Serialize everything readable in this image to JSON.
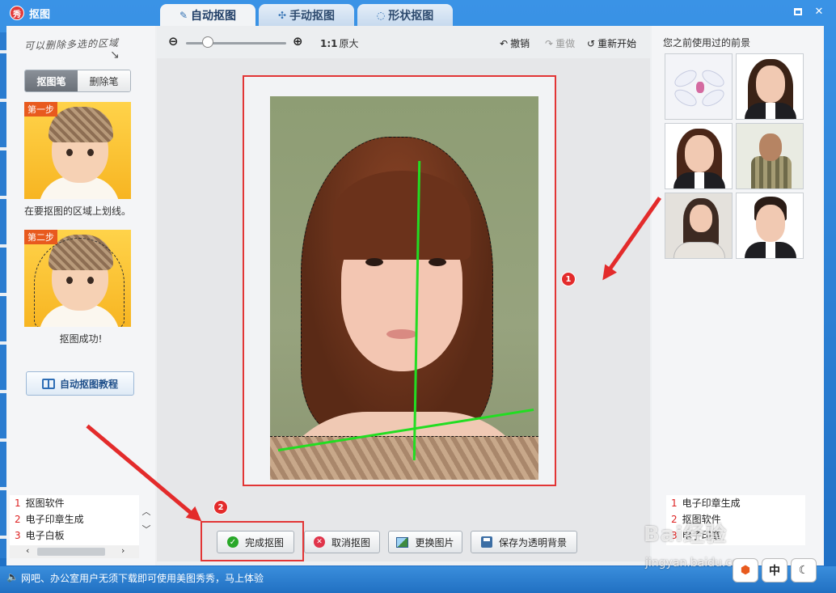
{
  "app": {
    "title": "抠图",
    "logo_char": "秀"
  },
  "tabs": [
    {
      "label": "自动抠图",
      "active": true
    },
    {
      "label": "手动抠图",
      "active": false
    },
    {
      "label": "形状抠图",
      "active": false
    }
  ],
  "left_panel": {
    "hint": "可以删除多选的区域",
    "brush_buttons": [
      "抠图笔",
      "删除笔"
    ],
    "step1_tag": "第一步",
    "step1_caption": "在要抠图的区域上划线。",
    "step2_tag": "第二步",
    "step2_caption": "抠图成功!",
    "tutorial_button": "自动抠图教程"
  },
  "left_ads": [
    {
      "n": "1",
      "text": "抠图软件"
    },
    {
      "n": "2",
      "text": "电子印章生成"
    },
    {
      "n": "3",
      "text": "电子白板"
    }
  ],
  "toolbar": {
    "zoom_label_bold": "1:1",
    "zoom_label": "原大",
    "undo": "撤销",
    "redo": "重做",
    "restart": "重新开始"
  },
  "bottom_buttons": {
    "finish": "完成抠图",
    "cancel": "取消抠图",
    "replace": "更换图片",
    "save": "保存为透明背景"
  },
  "right_panel": {
    "title": "您之前使用过的前景"
  },
  "right_ads": [
    {
      "n": "1",
      "text": "电子印章生成"
    },
    {
      "n": "2",
      "text": "抠图软件"
    },
    {
      "n": "3",
      "text": "电子印章"
    }
  ],
  "annotations": {
    "badge1": "1",
    "badge2": "2"
  },
  "status": {
    "text": "网吧、办公室用户无须下载即可使用美图秀秀，马上体验"
  },
  "corner_buttons": [
    "中"
  ],
  "watermark": {
    "brand": "Bai经验",
    "url": "jingyan.baidu.com"
  },
  "colors": {
    "accent_red": "#e32b2b",
    "frame_blue": "#2b7fd3",
    "stroke_green": "#22dd22"
  }
}
